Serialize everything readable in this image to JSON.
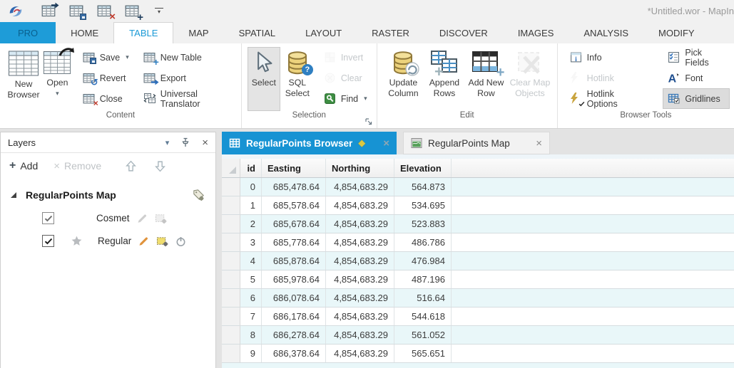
{
  "titlebar": {
    "title": "*Untitled.wor - MapIn",
    "quick_access_icons": [
      "open-table-icon",
      "save-table-icon",
      "close-table-icon",
      "new-table-icon"
    ]
  },
  "ribbon_tabs": {
    "items": [
      {
        "label": "PRO"
      },
      {
        "label": "HOME"
      },
      {
        "label": "TABLE"
      },
      {
        "label": "MAP"
      },
      {
        "label": "SPATIAL"
      },
      {
        "label": "LAYOUT"
      },
      {
        "label": "RASTER"
      },
      {
        "label": "DISCOVER"
      },
      {
        "label": "IMAGES"
      },
      {
        "label": "ANALYSIS"
      },
      {
        "label": "MODIFY"
      }
    ]
  },
  "ribbon": {
    "content": {
      "group_label": "Content",
      "new_browser": "New Browser",
      "open": "Open",
      "save": "Save",
      "revert": "Revert",
      "close": "Close",
      "new_table": "New Table",
      "export": "Export",
      "universal_translator": "Universal Translator"
    },
    "selection": {
      "group_label": "Selection",
      "select": "Select",
      "sql_select": "SQL Select",
      "invert": "Invert",
      "clear": "Clear",
      "find": "Find"
    },
    "edit": {
      "group_label": "Edit",
      "update_column": "Update Column",
      "append_rows": "Append Rows",
      "add_new_row": "Add New Row",
      "clear_map_objects": "Clear Map Objects"
    },
    "browser_tools": {
      "group_label": "Browser Tools",
      "info": "Info",
      "hotlink": "Hotlink",
      "hotlink_options": "Hotlink Options",
      "pick_fields": "Pick Fields",
      "font": "Font",
      "gridlines": "Gridlines"
    }
  },
  "layers_panel": {
    "title": "Layers",
    "toolbar": {
      "add": "Add",
      "remove": "Remove"
    },
    "map_group": "RegularPoints Map",
    "layers": [
      {
        "name": "Cosmet",
        "checked": true,
        "editable": false,
        "selectable": false
      },
      {
        "name": "Regular",
        "checked": true,
        "editable": true,
        "selectable": true
      }
    ]
  },
  "document_tabs": {
    "items": [
      {
        "label": "RegularPoints Browser",
        "active": true,
        "modified": true
      },
      {
        "label": "RegularPoints Map",
        "active": false
      }
    ]
  },
  "browser": {
    "columns": [
      "id",
      "Easting",
      "Northing",
      "Elevation"
    ],
    "rows": [
      [
        "0",
        "685,478.64",
        "4,854,683.29",
        "564.873"
      ],
      [
        "1",
        "685,578.64",
        "4,854,683.29",
        "534.695"
      ],
      [
        "2",
        "685,678.64",
        "4,854,683.29",
        "523.883"
      ],
      [
        "3",
        "685,778.64",
        "4,854,683.29",
        "486.786"
      ],
      [
        "4",
        "685,878.64",
        "4,854,683.29",
        "476.984"
      ],
      [
        "5",
        "685,978.64",
        "4,854,683.29",
        "487.196"
      ],
      [
        "6",
        "686,078.64",
        "4,854,683.29",
        "516.64"
      ],
      [
        "7",
        "686,178.64",
        "4,854,683.29",
        "544.618"
      ],
      [
        "8",
        "686,278.64",
        "4,854,683.29",
        "561.052"
      ],
      [
        "9",
        "686,378.64",
        "4,854,683.29",
        "565.651"
      ]
    ]
  },
  "icon_glyphs": {
    "diamond": "◆",
    "close": "×",
    "dropdown": "▾",
    "plus": "+",
    "question": "?",
    "revert": "↺",
    "up": "⇧",
    "down": "⇩",
    "remove_x": "×"
  },
  "colors": {
    "accent": "#1b9ad6",
    "active_doc_tab": "#1793d3",
    "row_stripe": "#e9f7f9",
    "pro_tab": "#1e9cd8",
    "modified_diamond": "#dcc83f"
  }
}
